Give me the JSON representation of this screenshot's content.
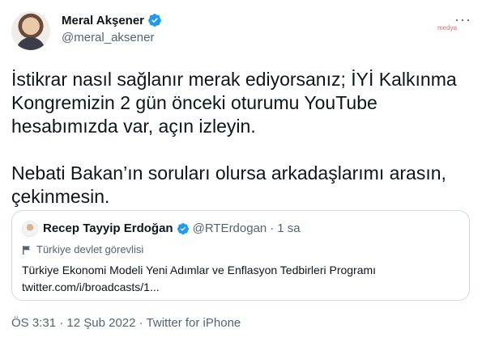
{
  "author": {
    "name": "Meral Akşener",
    "handle": "@meral_aksener"
  },
  "watermark": "medya",
  "tweet_text": "İstikrar nasıl sağlanır merak ediyorsanız; İYİ Kalkınma\nKongremizin 2 gün önceki oturumu YouTube\nhesabımızda var, açın izleyin.\n\nNebati Bakan’ın soruları olursa arkadaşlarımı arasın,\nçekinmesin.",
  "quoted": {
    "name": "Recep Tayyip Erdoğan",
    "handle": "@RTErdogan",
    "separator": "·",
    "time": "1 sa",
    "label": "Türkiye devlet görevlisi",
    "line1": "Türkiye Ekonomi Modeli Yeni Adımlar ve Enflasyon Tedbirleri Programı",
    "line2": "twitter.com/i/broadcasts/1..."
  },
  "meta": {
    "time": "ÖS 3:31",
    "sep": "·",
    "date": "12 Şub 2022",
    "sep2": "·",
    "source": "Twitter for iPhone"
  },
  "colors": {
    "verified": "#1d9bf0",
    "secondary_text": "#536471",
    "border": "#cfd9de"
  },
  "icons": [
    "verified-badge-icon",
    "more-options-icon",
    "government-flag-icon"
  ]
}
